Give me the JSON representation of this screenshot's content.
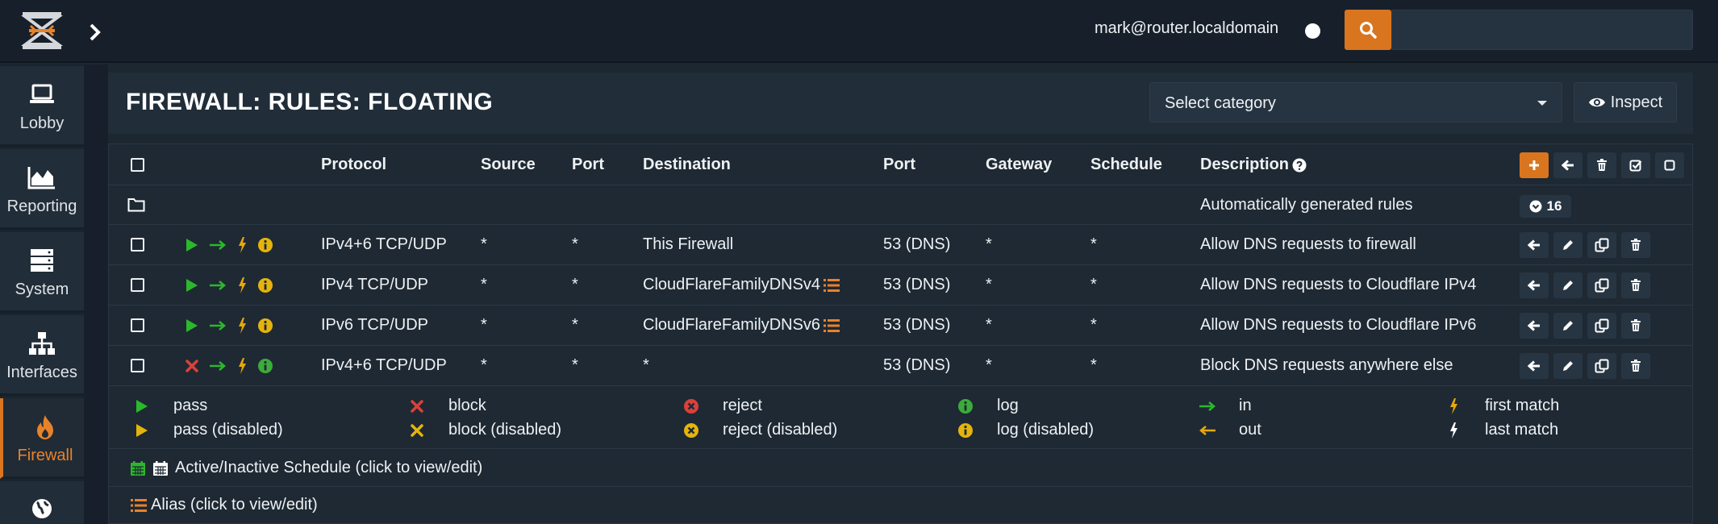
{
  "topbar": {
    "user": "mark@router.localdomain",
    "search_placeholder": ""
  },
  "sidebar": {
    "items": [
      {
        "label": "Lobby",
        "icon": "laptop-icon"
      },
      {
        "label": "Reporting",
        "icon": "area-chart-icon"
      },
      {
        "label": "System",
        "icon": "server-icon"
      },
      {
        "label": "Interfaces",
        "icon": "sitemap-icon"
      },
      {
        "label": "Firewall",
        "icon": "fire-icon",
        "active": true
      },
      {
        "label": "",
        "icon": "globe-icon"
      }
    ]
  },
  "header": {
    "title": "FIREWALL: RULES: FLOATING",
    "select_category": "Select category",
    "inspect_label": "Inspect"
  },
  "table": {
    "columns": [
      "Protocol",
      "Source",
      "Port",
      "Destination",
      "Port",
      "Gateway",
      "Schedule",
      "Description"
    ],
    "group": {
      "label": "Automatically generated rules",
      "count": "16"
    },
    "rows": [
      {
        "action": "pass",
        "protocol": "IPv4+6 TCP/UDP",
        "source": "*",
        "source_port": "*",
        "destination": "This Firewall",
        "dest_alias": false,
        "dest_port": "53 (DNS)",
        "gateway": "*",
        "schedule": "*",
        "description": "Allow DNS requests to firewall"
      },
      {
        "action": "pass",
        "protocol": "IPv4 TCP/UDP",
        "source": "*",
        "source_port": "*",
        "destination": "CloudFlareFamilyDNSv4",
        "dest_alias": true,
        "dest_port": "53 (DNS)",
        "gateway": "*",
        "schedule": "*",
        "description": "Allow DNS requests to Cloudflare IPv4"
      },
      {
        "action": "pass",
        "protocol": "IPv6 TCP/UDP",
        "source": "*",
        "source_port": "*",
        "destination": "CloudFlareFamilyDNSv6",
        "dest_alias": true,
        "dest_port": "53 (DNS)",
        "gateway": "*",
        "schedule": "*",
        "description": "Allow DNS requests to Cloudflare IPv6"
      },
      {
        "action": "block",
        "protocol": "IPv4+6 TCP/UDP",
        "source": "*",
        "source_port": "*",
        "destination": "*",
        "dest_alias": false,
        "dest_port": "53 (DNS)",
        "gateway": "*",
        "schedule": "*",
        "description": "Block DNS requests anywhere else"
      }
    ]
  },
  "legend": {
    "items": [
      {
        "label": "pass"
      },
      {
        "label": "pass (disabled)"
      },
      {
        "label": "block"
      },
      {
        "label": "block (disabled)"
      },
      {
        "label": "reject"
      },
      {
        "label": "reject (disabled)"
      },
      {
        "label": "log"
      },
      {
        "label": "log (disabled)"
      },
      {
        "label": "in"
      },
      {
        "label": "out"
      },
      {
        "label": "first match"
      },
      {
        "label": "last match"
      }
    ],
    "schedule_text": "Active/Inactive Schedule (click to view/edit)",
    "alias_text": "Alias (click to view/edit)"
  },
  "colors": {
    "accent": "#d9751e",
    "pass": "#2bb82b",
    "pass_disabled": "#e5b40c",
    "block": "#d9413a",
    "info": "#e5b40c",
    "log": "#3cab3c",
    "background": "#1c2730"
  }
}
